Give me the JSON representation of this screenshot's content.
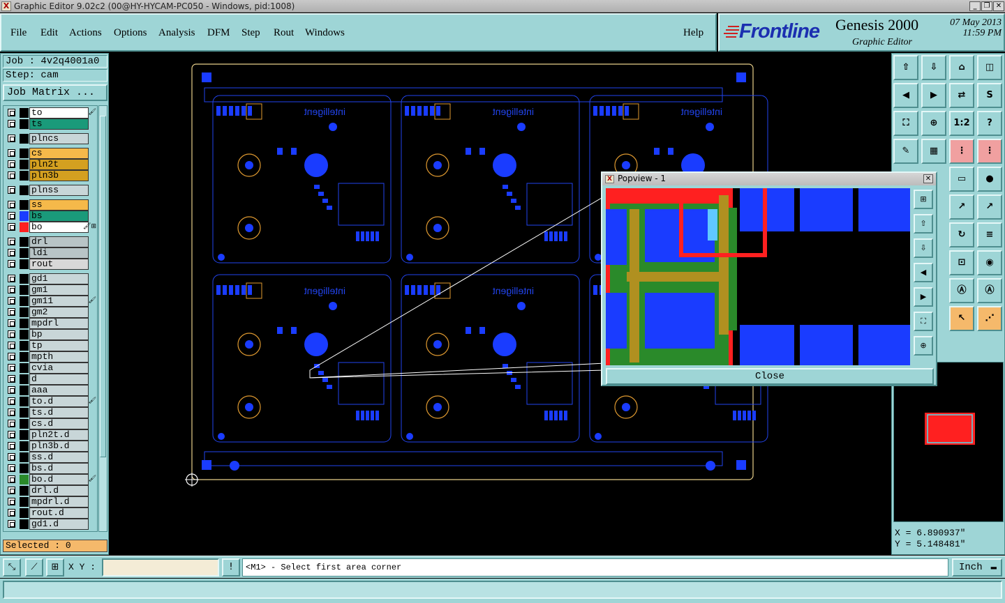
{
  "window": {
    "title": "Graphic Editor 9.02c2 (00@HY-HYCAM-PC050 - Windows, pid:1008)"
  },
  "menu": {
    "items": [
      "File",
      "Edit",
      "Actions",
      "Options",
      "Analysis",
      "DFM",
      "Step",
      "Rout",
      "Windows"
    ],
    "help": "Help"
  },
  "brand": {
    "logo": "Frontline",
    "product": "Genesis 2000",
    "subtitle": "Graphic Editor",
    "date": "07 May 2013",
    "time": "11:59 PM"
  },
  "job": {
    "job_label": "Job : 4v2q4001a0",
    "step_label": "Step: cam",
    "matrix_button": "Job Matrix ..."
  },
  "layers": [
    {
      "name": "to",
      "color": "#ffffff",
      "swatch": "#000000",
      "mark": "🖌"
    },
    {
      "name": "ts",
      "color": "#1a9a7a",
      "swatch": "#000000",
      "mark": ""
    },
    {
      "name": "plncs",
      "color": "#c8d6d8",
      "swatch": "#000000",
      "mark": ""
    },
    {
      "name": "cs",
      "color": "#f5b94a",
      "swatch": "#000000",
      "mark": ""
    },
    {
      "name": "pln2t",
      "color": "#d4a020",
      "swatch": "#000000",
      "mark": ""
    },
    {
      "name": "pln3b",
      "color": "#d4a020",
      "swatch": "#000000",
      "mark": ""
    },
    {
      "name": "plnss",
      "color": "#c8d6d8",
      "swatch": "#000000",
      "mark": ""
    },
    {
      "name": "ss",
      "color": "#f5b94a",
      "swatch": "#000000",
      "mark": ""
    },
    {
      "name": "bs",
      "color": "#1a9a7a",
      "swatch": "#1a3cff",
      "mark": ""
    },
    {
      "name": "bo",
      "color": "#ffffff",
      "swatch": "#ff2020",
      "mark": "🖌⊞"
    },
    {
      "name": "drl",
      "color": "#b8c4c6",
      "swatch": "#000000",
      "mark": ""
    },
    {
      "name": "ldi",
      "color": "#b8c4c6",
      "swatch": "#000000",
      "mark": ""
    },
    {
      "name": "rout",
      "color": "#d8d8d8",
      "swatch": "#000000",
      "mark": ""
    },
    {
      "name": "gd1",
      "color": "#c8d6d8",
      "swatch": "#000000",
      "mark": ""
    },
    {
      "name": "gm1",
      "color": "#c8d6d8",
      "swatch": "#000000",
      "mark": ""
    },
    {
      "name": "gm11",
      "color": "#c8d6d8",
      "swatch": "#000000",
      "mark": "🖌"
    },
    {
      "name": "gm2",
      "color": "#c8d6d8",
      "swatch": "#000000",
      "mark": ""
    },
    {
      "name": "mpdrl",
      "color": "#c8d6d8",
      "swatch": "#000000",
      "mark": ""
    },
    {
      "name": "bp",
      "color": "#c8d6d8",
      "swatch": "#000000",
      "mark": ""
    },
    {
      "name": "tp",
      "color": "#c8d6d8",
      "swatch": "#000000",
      "mark": ""
    },
    {
      "name": "mpth",
      "color": "#c8d6d8",
      "swatch": "#000000",
      "mark": ""
    },
    {
      "name": "cvia",
      "color": "#c8d6d8",
      "swatch": "#000000",
      "mark": ""
    },
    {
      "name": "d",
      "color": "#c8d6d8",
      "swatch": "#000000",
      "mark": ""
    },
    {
      "name": "aaa",
      "color": "#c8d6d8",
      "swatch": "#000000",
      "mark": ""
    },
    {
      "name": "to.d",
      "color": "#c8d6d8",
      "swatch": "#000000",
      "mark": "🖌"
    },
    {
      "name": "ts.d",
      "color": "#c8d6d8",
      "swatch": "#000000",
      "mark": ""
    },
    {
      "name": "cs.d",
      "color": "#c8d6d8",
      "swatch": "#000000",
      "mark": ""
    },
    {
      "name": "pln2t.d",
      "color": "#c8d6d8",
      "swatch": "#000000",
      "mark": ""
    },
    {
      "name": "pln3b.d",
      "color": "#c8d6d8",
      "swatch": "#000000",
      "mark": ""
    },
    {
      "name": "ss.d",
      "color": "#c8d6d8",
      "swatch": "#000000",
      "mark": ""
    },
    {
      "name": "bs.d",
      "color": "#c8d6d8",
      "swatch": "#000000",
      "mark": ""
    },
    {
      "name": "bo.d",
      "color": "#c8d6d8",
      "swatch": "#2a8a2a",
      "mark": "🖌"
    },
    {
      "name": "drl.d",
      "color": "#c8d6d8",
      "swatch": "#000000",
      "mark": ""
    },
    {
      "name": "mpdrl.d",
      "color": "#c8d6d8",
      "swatch": "#000000",
      "mark": ""
    },
    {
      "name": "rout.d",
      "color": "#c8d6d8",
      "swatch": "#000000",
      "mark": ""
    },
    {
      "name": "gd1.d",
      "color": "#c8d6d8",
      "swatch": "#000000",
      "mark": ""
    }
  ],
  "selected": "Selected : 0",
  "board": {
    "silkscreen_text": "intelligent"
  },
  "popview": {
    "title": "Popview - 1",
    "close_label": "Close"
  },
  "tools": {
    "ratio_label": "1:2",
    "help_label": "?"
  },
  "coords": {
    "x": "X = 6.890937\"",
    "y": "Y = 5.148481\""
  },
  "status": {
    "xy_label": "X Y :",
    "xy_value": "",
    "prompt": "<M1> - Select first area corner",
    "unit": "Inch"
  },
  "colors": {
    "panel": "#9ed5d6",
    "board_outline": "#e8d08a",
    "board_blue": "#1a3cff",
    "trace": "#2244ee",
    "popup_red": "#ff2020",
    "popup_green": "#2a8a2a"
  }
}
